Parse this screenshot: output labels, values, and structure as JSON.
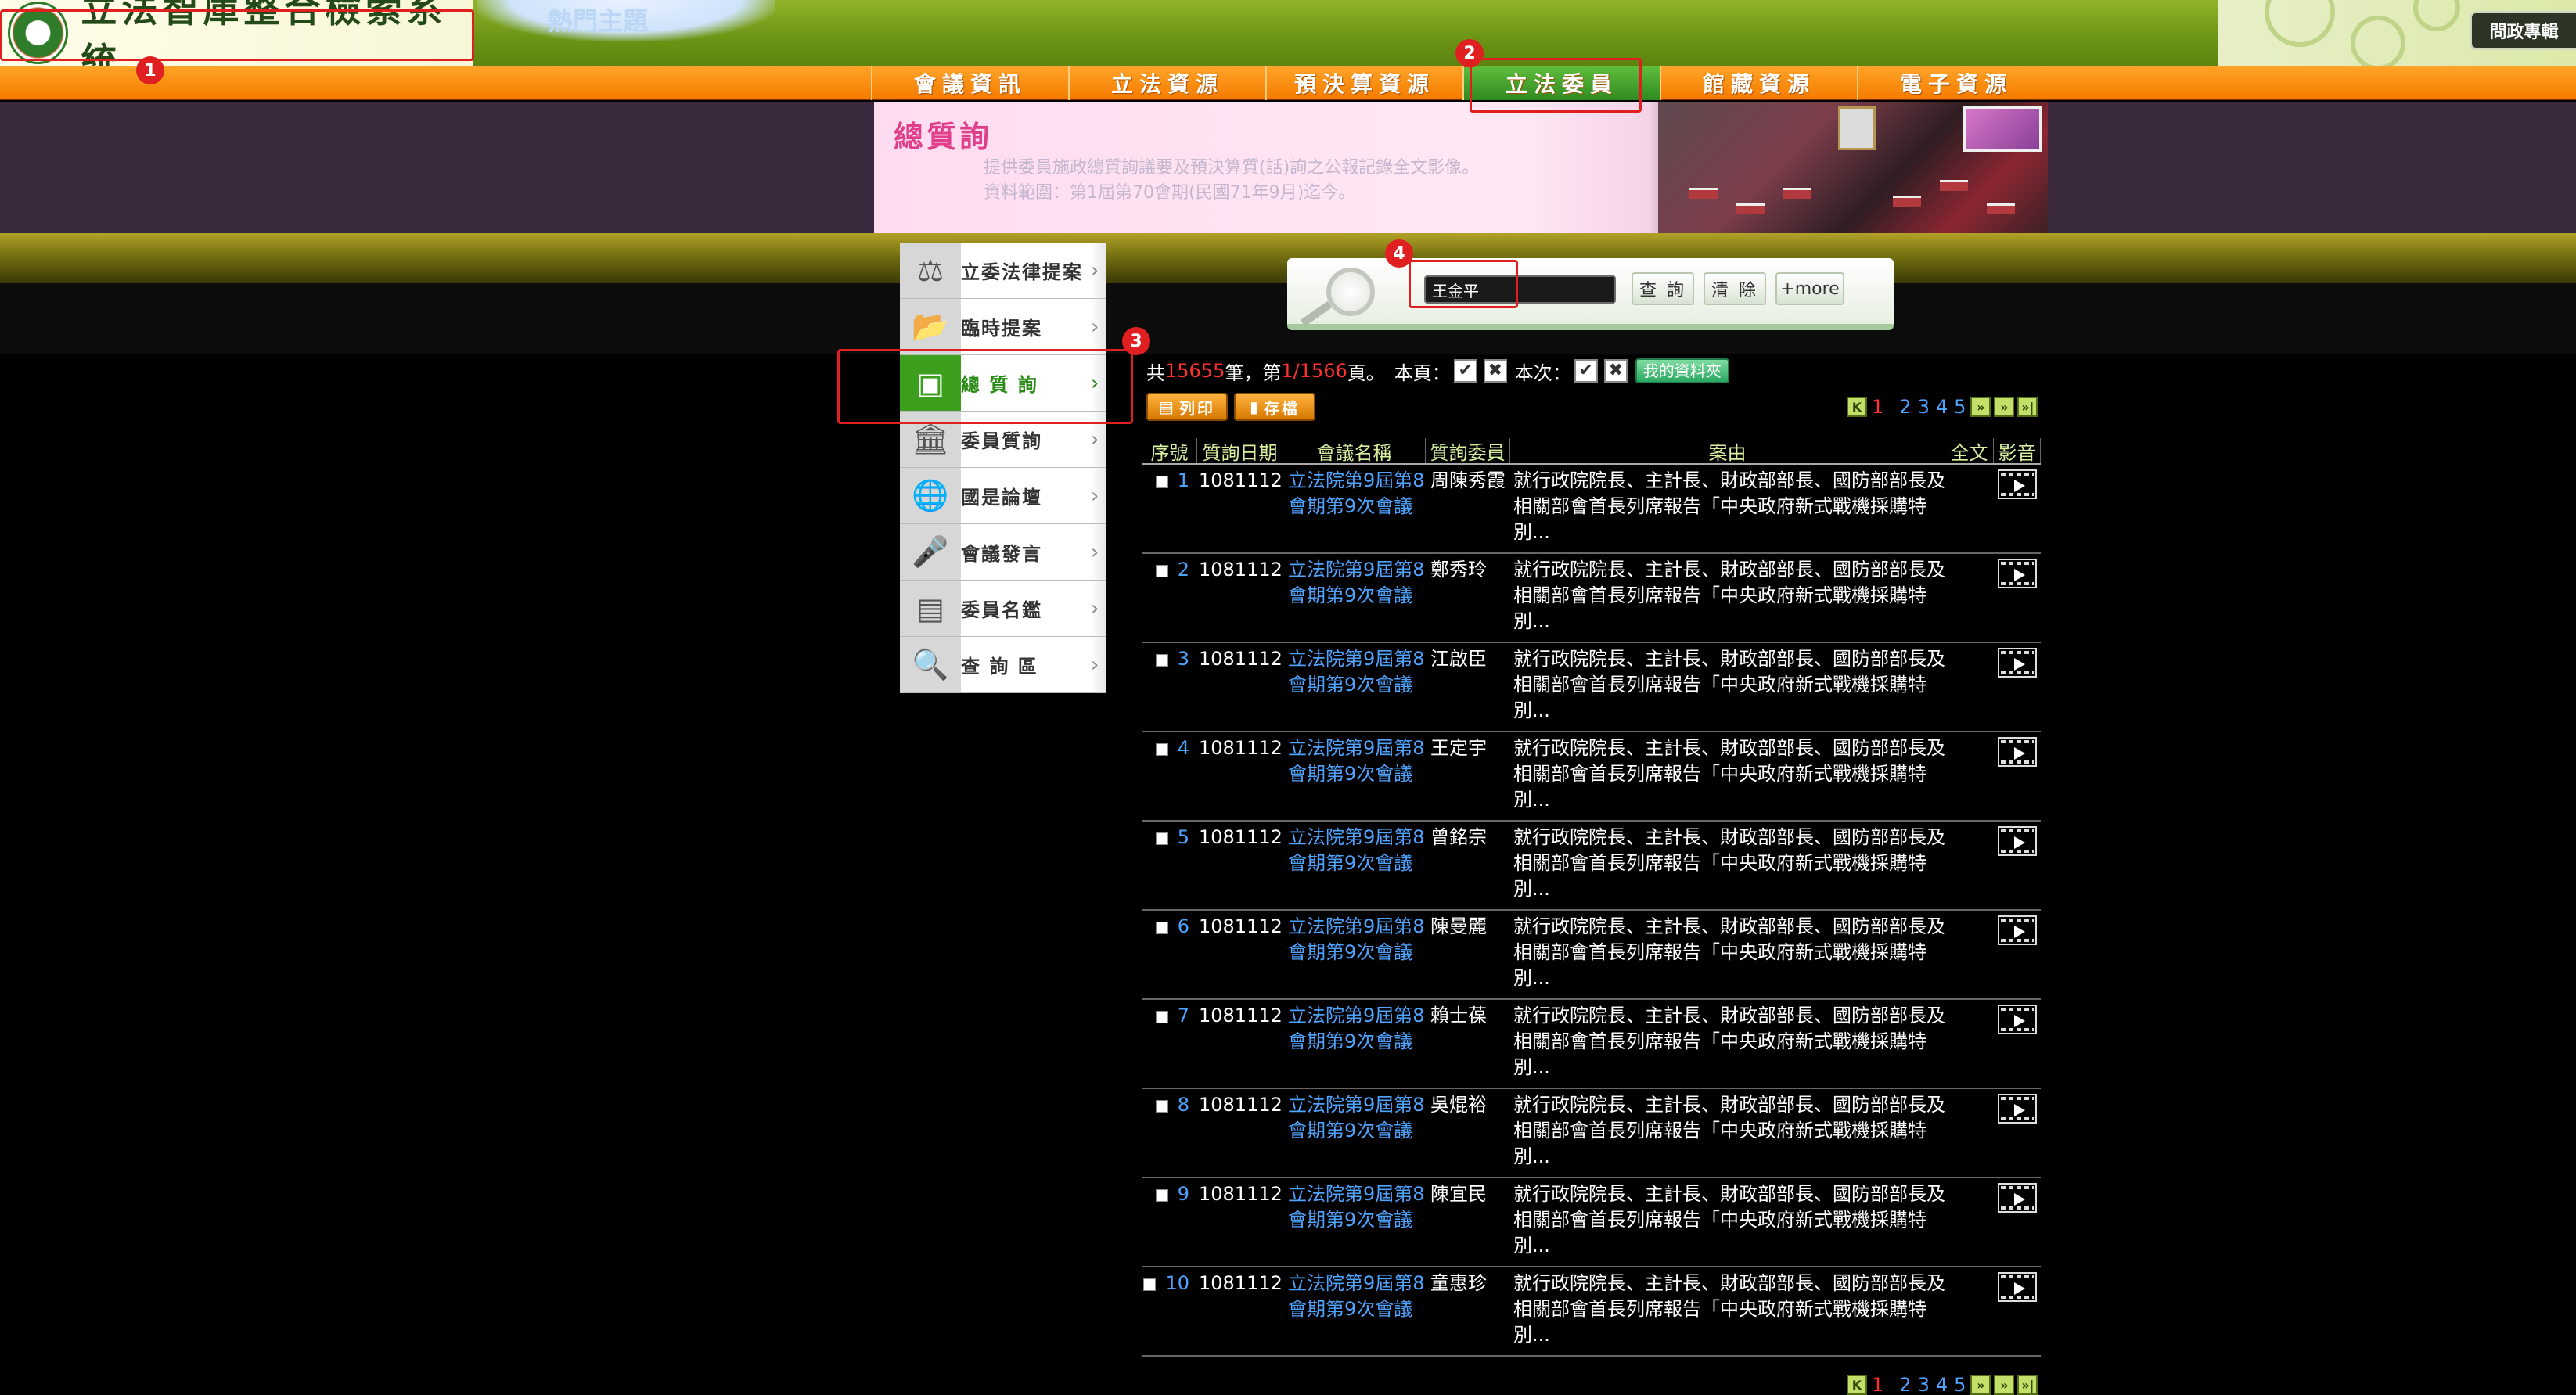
{
  "header": {
    "site_title": "立法智庫整合檢索系統",
    "hot_topic": "熱門主題",
    "special_topic": "問政專輯"
  },
  "nav": {
    "items": [
      {
        "label": "會議資訊",
        "active": false
      },
      {
        "label": "立法資源",
        "active": false
      },
      {
        "label": "預決算資源",
        "active": false
      },
      {
        "label": "立法委員",
        "active": true
      },
      {
        "label": "館藏資源",
        "active": false
      },
      {
        "label": "電子資源",
        "active": false
      }
    ]
  },
  "banner": {
    "title": "總質詢",
    "desc_line1": "提供委員施政總質詢議要及預決算質(話)詢之公報記錄全文影像。",
    "desc_line2": "資料範圍：第1屆第70會期(民國71年9月)迄今。"
  },
  "sidebar": {
    "items": [
      {
        "label": "立委法律提案",
        "icon": "scale-icon",
        "glyph": "⚖",
        "active": false
      },
      {
        "label": "臨時提案",
        "icon": "folder-icon",
        "glyph": "📂",
        "active": false
      },
      {
        "label": "總 質 詢",
        "icon": "podium-icon",
        "glyph": "▣",
        "active": true
      },
      {
        "label": "委員質詢",
        "icon": "building-icon",
        "glyph": "🏛",
        "active": false
      },
      {
        "label": "國是論壇",
        "icon": "globe-icon",
        "glyph": "🌐",
        "active": false
      },
      {
        "label": "會議發言",
        "icon": "microphone-icon",
        "glyph": "🎤",
        "active": false
      },
      {
        "label": "委員名鑑",
        "icon": "directory-icon",
        "glyph": "▤",
        "active": false
      },
      {
        "label": "查 詢 區",
        "icon": "search-icon",
        "glyph": "🔍",
        "active": false
      }
    ]
  },
  "search": {
    "value": "王金平",
    "query_label": "查 詢",
    "clear_label": "清 除",
    "more_label": "+more"
  },
  "summary": {
    "prefix": "共",
    "total": "15655",
    "mid": "筆，第",
    "page": "1/1566",
    "suffix": "頁。",
    "this_page": "本頁：",
    "this_time": "本次：",
    "check_glyph": "✔",
    "cross_glyph": "✖",
    "my_folder": "我的資料夾"
  },
  "actions": {
    "print": "列印",
    "save": "存檔"
  },
  "pager": {
    "pages": [
      "1",
      "2",
      "3",
      "4",
      "5"
    ],
    "current": "1",
    "first": "K",
    "prev": "»",
    "next": "»",
    "last": "»|"
  },
  "table": {
    "headers": [
      "序號",
      "質詢日期",
      "會議名稱",
      "質詢委員",
      "案由",
      "全文",
      "影音"
    ],
    "rows": [
      {
        "no": "1",
        "date": "1081112",
        "meeting": "立法院第9屆第8會期第9次會議",
        "member": "周陳秀霞",
        "reason": "就行政院院長、主計長、財政部部長、國防部部長及相關部會首長列席報告「中央政府新式戰機採購特別..."
      },
      {
        "no": "2",
        "date": "1081112",
        "meeting": "立法院第9屆第8會期第9次會議",
        "member": "鄭秀玲",
        "reason": "就行政院院長、主計長、財政部部長、國防部部長及相關部會首長列席報告「中央政府新式戰機採購特別..."
      },
      {
        "no": "3",
        "date": "1081112",
        "meeting": "立法院第9屆第8會期第9次會議",
        "member": "江啟臣",
        "reason": "就行政院院長、主計長、財政部部長、國防部部長及相關部會首長列席報告「中央政府新式戰機採購特別..."
      },
      {
        "no": "4",
        "date": "1081112",
        "meeting": "立法院第9屆第8會期第9次會議",
        "member": "王定宇",
        "reason": "就行政院院長、主計長、財政部部長、國防部部長及相關部會首長列席報告「中央政府新式戰機採購特別..."
      },
      {
        "no": "5",
        "date": "1081112",
        "meeting": "立法院第9屆第8會期第9次會議",
        "member": "曾銘宗",
        "reason": "就行政院院長、主計長、財政部部長、國防部部長及相關部會首長列席報告「中央政府新式戰機採購特別..."
      },
      {
        "no": "6",
        "date": "1081112",
        "meeting": "立法院第9屆第8會期第9次會議",
        "member": "陳曼麗",
        "reason": "就行政院院長、主計長、財政部部長、國防部部長及相關部會首長列席報告「中央政府新式戰機採購特別..."
      },
      {
        "no": "7",
        "date": "1081112",
        "meeting": "立法院第9屆第8會期第9次會議",
        "member": "賴士葆",
        "reason": "就行政院院長、主計長、財政部部長、國防部部長及相關部會首長列席報告「中央政府新式戰機採購特別..."
      },
      {
        "no": "8",
        "date": "1081112",
        "meeting": "立法院第9屆第8會期第9次會議",
        "member": "吳焜裕",
        "reason": "就行政院院長、主計長、財政部部長、國防部部長及相關部會首長列席報告「中央政府新式戰機採購特別..."
      },
      {
        "no": "9",
        "date": "1081112",
        "meeting": "立法院第9屆第8會期第9次會議",
        "member": "陳宜民",
        "reason": "就行政院院長、主計長、財政部部長、國防部部長及相關部會首長列席報告「中央政府新式戰機採購特別..."
      },
      {
        "no": "10",
        "date": "1081112",
        "meeting": "立法院第9屆第8會期第9次會議",
        "member": "童惠珍",
        "reason": "就行政院院長、主計長、財政部部長、國防部部長及相關部會首長列席報告「中央政府新式戰機採購特別..."
      }
    ]
  },
  "annotations": [
    "1",
    "2",
    "3",
    "4"
  ],
  "colors": {
    "accent_green": "#3c9f1e",
    "nav_orange": "#f57c00",
    "link_blue": "#4ea3ff",
    "highlight_red": "#ff3030",
    "annotation_red": "#e02020"
  }
}
